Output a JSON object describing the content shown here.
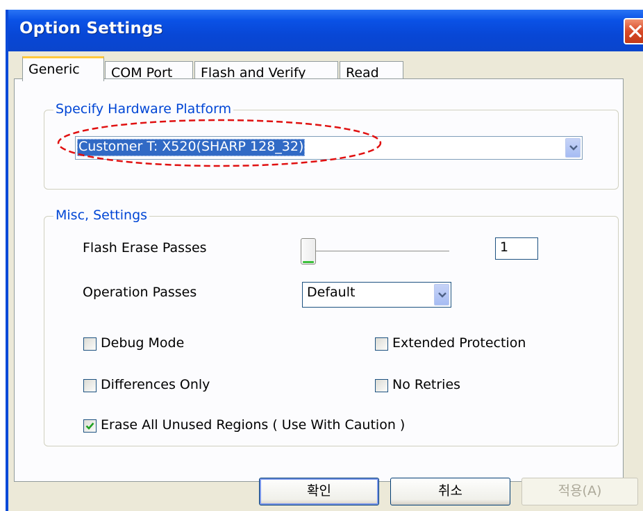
{
  "window": {
    "title": "Option Settings",
    "colors": {
      "titlebar": "#0a52e6",
      "face": "#ece9d8",
      "accent": "#0046d5",
      "selection": "#316ac5"
    }
  },
  "tabs": [
    {
      "label": "Generic",
      "active": true
    },
    {
      "label": "COM Port",
      "active": false
    },
    {
      "label": "Flash and Verify",
      "active": false
    },
    {
      "label": "Read",
      "active": false
    }
  ],
  "hardware_group": {
    "title": "Specify Hardware Platform",
    "platform_value": "Customer T: X520(SHARP 128_32)"
  },
  "misc_group": {
    "title": "Misc, Settings",
    "flash_erase_passes_label": "Flash Erase Passes",
    "flash_erase_passes_value": "1",
    "operation_passes_label": "Operation Passes",
    "operation_passes_value": "Default",
    "checkboxes": {
      "debug_mode": {
        "label": "Debug Mode",
        "checked": false
      },
      "extended_protection": {
        "label": "Extended Protection",
        "checked": false
      },
      "differences_only": {
        "label": "Differences Only",
        "checked": false
      },
      "no_retries": {
        "label": "No Retries",
        "checked": false
      },
      "erase_all_unused": {
        "label": "Erase All Unused Regions ( Use With Caution )",
        "checked": true
      }
    }
  },
  "buttons": {
    "ok": "확인",
    "cancel": "취소",
    "apply": "적용(A)"
  },
  "icons": {
    "close": "close-icon",
    "dropdown": "chevron-down-icon",
    "check": "checkmark-icon"
  }
}
